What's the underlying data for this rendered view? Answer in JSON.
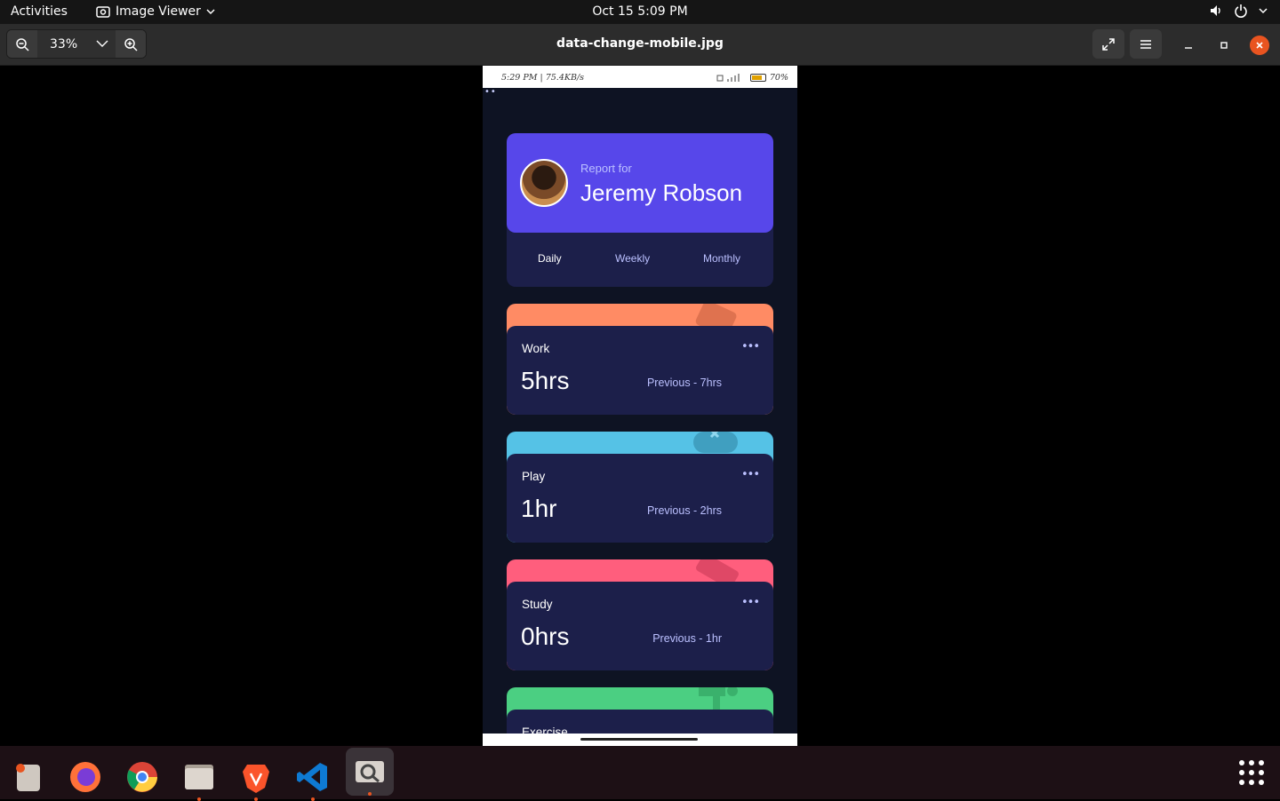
{
  "system_bar": {
    "activities": "Activities",
    "app_name": "Image Viewer",
    "clock": "Oct 15  5:09 PM"
  },
  "viewer": {
    "zoom": "33%",
    "file_name": "data-change-mobile.jpg"
  },
  "phone": {
    "status_left": "5:29 PM | 75.4KB/s",
    "battery": "70%",
    "profile": {
      "report_for": "Report for",
      "name": "Jeremy Robson"
    },
    "tabs": [
      "Daily",
      "Weekly",
      "Monthly"
    ],
    "active_tab": "Daily",
    "cards": [
      {
        "title": "Work",
        "hours": "5hrs",
        "previous": "Previous - 7hrs",
        "color": "#ff8b64"
      },
      {
        "title": "Play",
        "hours": "1hr",
        "previous": "Previous - 2hrs",
        "color": "#55c2e6"
      },
      {
        "title": "Study",
        "hours": "0hrs",
        "previous": "Previous - 1hr",
        "color": "#ff5e7d"
      },
      {
        "title": "Exercise",
        "color": "#4bcf82"
      }
    ]
  },
  "colors": {
    "accent": "#5747ea",
    "card_bg": "#1c1f4a",
    "page_bg": "#0e1323",
    "muted_text": "#bbc0ff"
  },
  "dock": [
    "files-icon",
    "firefox-icon",
    "chrome-icon",
    "file-manager-icon",
    "brave-icon",
    "vscode-icon",
    "image-viewer-icon"
  ]
}
